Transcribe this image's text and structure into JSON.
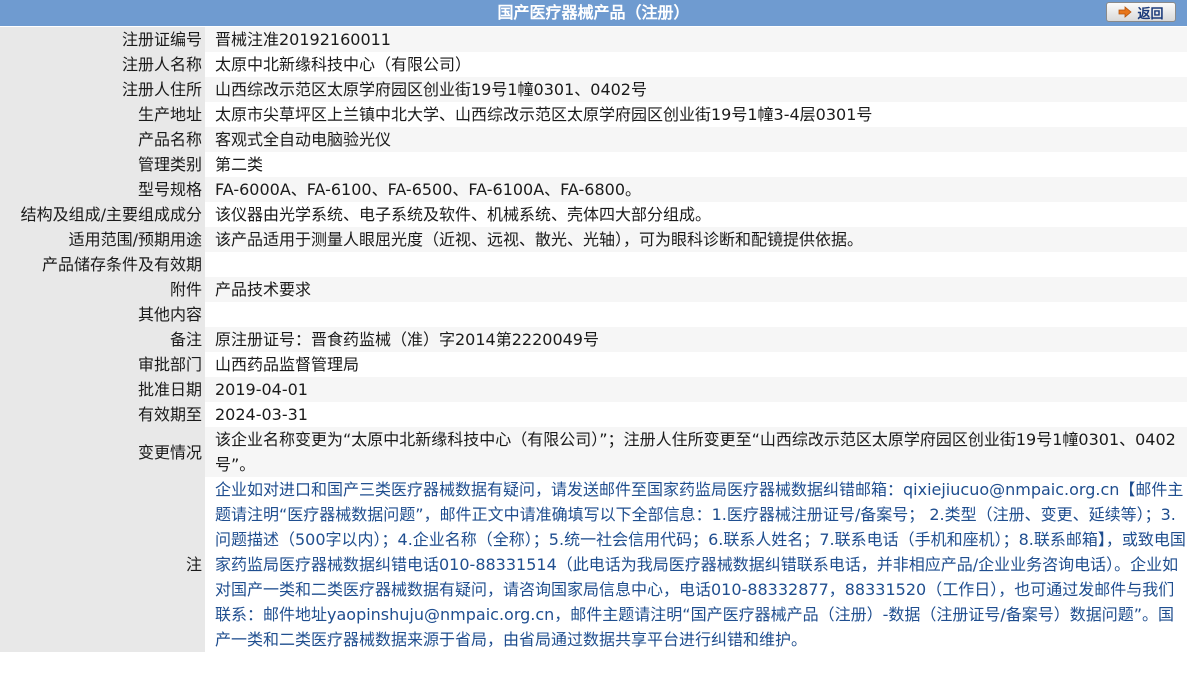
{
  "header": {
    "title": "国产医疗器械产品（注册）",
    "back_label": "返回",
    "back_icon": "arrow-right-icon"
  },
  "rows": [
    {
      "label": "注册证编号",
      "value": "晋械注准20192160011"
    },
    {
      "label": "注册人名称",
      "value": "太原中北新缘科技中心（有限公司）"
    },
    {
      "label": "注册人住所",
      "value": "山西综改示范区太原学府园区创业街19号1幢0301、0402号"
    },
    {
      "label": "生产地址",
      "value": "太原市尖草坪区上兰镇中北大学、山西综改示范区太原学府园区创业街19号1幢3-4层0301号"
    },
    {
      "label": "产品名称",
      "value": "客观式全自动电脑验光仪"
    },
    {
      "label": "管理类别",
      "value": "第二类"
    },
    {
      "label": "型号规格",
      "value": "FA-6000A、FA-6100、FA-6500、FA-6100A、FA-6800。"
    },
    {
      "label": "结构及组成/主要组成成分",
      "value": "该仪器由光学系统、电子系统及软件、机械系统、壳体四大部分组成。"
    },
    {
      "label": "适用范围/预期用途",
      "value": "该产品适用于测量人眼屈光度（近视、远视、散光、光轴），可为眼科诊断和配镜提供依据。"
    },
    {
      "label": "产品储存条件及有效期",
      "value": ""
    },
    {
      "label": "附件",
      "value": "产品技术要求"
    },
    {
      "label": "其他内容",
      "value": ""
    },
    {
      "label": "备注",
      "value": "原注册证号：晋食药监械（准）字2014第2220049号"
    },
    {
      "label": "审批部门",
      "value": "山西药品监督管理局"
    },
    {
      "label": "批准日期",
      "value": "2019-04-01"
    },
    {
      "label": "有效期至",
      "value": "2024-03-31"
    }
  ],
  "change": {
    "label": "变更情况",
    "value": "该企业名称变更为“太原中北新缘科技中心（有限公司）”；注册人住所变更至“山西综改示范区太原学府园区创业街19号1幢0301、0402号”。"
  },
  "note": {
    "label": "注",
    "value": "企业如对进口和国产三类医疗器械数据有疑问，请发送邮件至国家药监局医疗器械数据纠错邮箱：qixiejiucuo@nmpaic.org.cn【邮件主题请注明“医疗器械数据问题”，邮件正文中请准确填写以下全部信息：1.医疗器械注册证号/备案号； 2.类型（注册、变更、延续等）；3.问题描述（500字以内）；4.企业名称（全称）；5.统一社会信用代码；6.联系人姓名；7.联系电话（手机和座机）；8.联系邮箱】，或致电国家药监局医疗器械数据纠错电话010-88331514（此电话为我局医疗器械数据纠错联系电话，并非相应产品/企业业务咨询电话）。企业如对国产一类和二类医疗器械数据有疑问，请咨询国家局信息中心，电话010-88332877，88331520（工作日），也可通过发邮件与我们联系：邮件地址yaopinshuju@nmpaic.org.cn，邮件主题请注明“国产医疗器械产品（注册）-数据（注册证号/备案号）数据问题”。国产一类和二类医疗器械数据来源于省局，由省局通过数据共享平台进行纠错和维护。",
    "color": "#1f4e8f"
  }
}
